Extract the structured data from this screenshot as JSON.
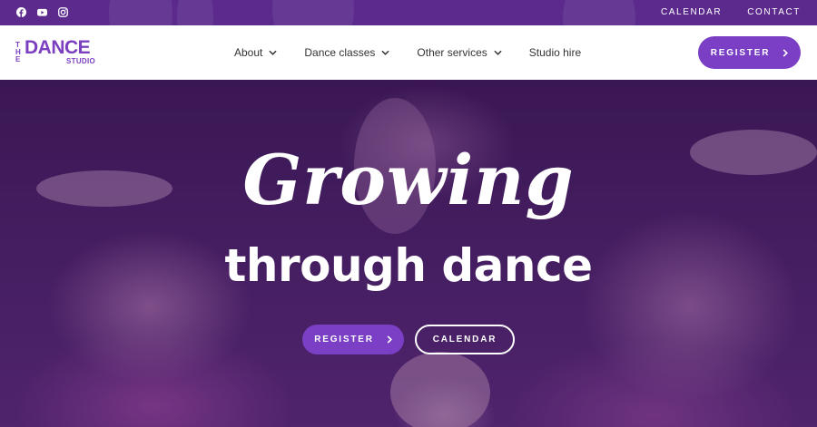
{
  "topbar": {
    "social": [
      {
        "icon": "facebook-icon"
      },
      {
        "icon": "youtube-icon"
      },
      {
        "icon": "instagram-icon"
      }
    ],
    "links": [
      "CALENDAR",
      "CONTACT"
    ]
  },
  "logo": {
    "the": "THE",
    "dance": "DANCE",
    "studio": "STUDIO"
  },
  "nav": {
    "items": [
      {
        "label": "About",
        "dropdown": true
      },
      {
        "label": "Dance classes",
        "dropdown": true
      },
      {
        "label": "Other services",
        "dropdown": true
      },
      {
        "label": "Studio hire",
        "dropdown": false
      }
    ],
    "register_label": "REGISTER"
  },
  "hero": {
    "script_title": "Growing",
    "bold_title": "through dance",
    "register_label": "REGISTER",
    "calendar_label": "CALENDAR"
  },
  "colors": {
    "brand_purple": "#7a3fc4",
    "topbar": "#5b2a8c",
    "text_dark": "#333333"
  }
}
